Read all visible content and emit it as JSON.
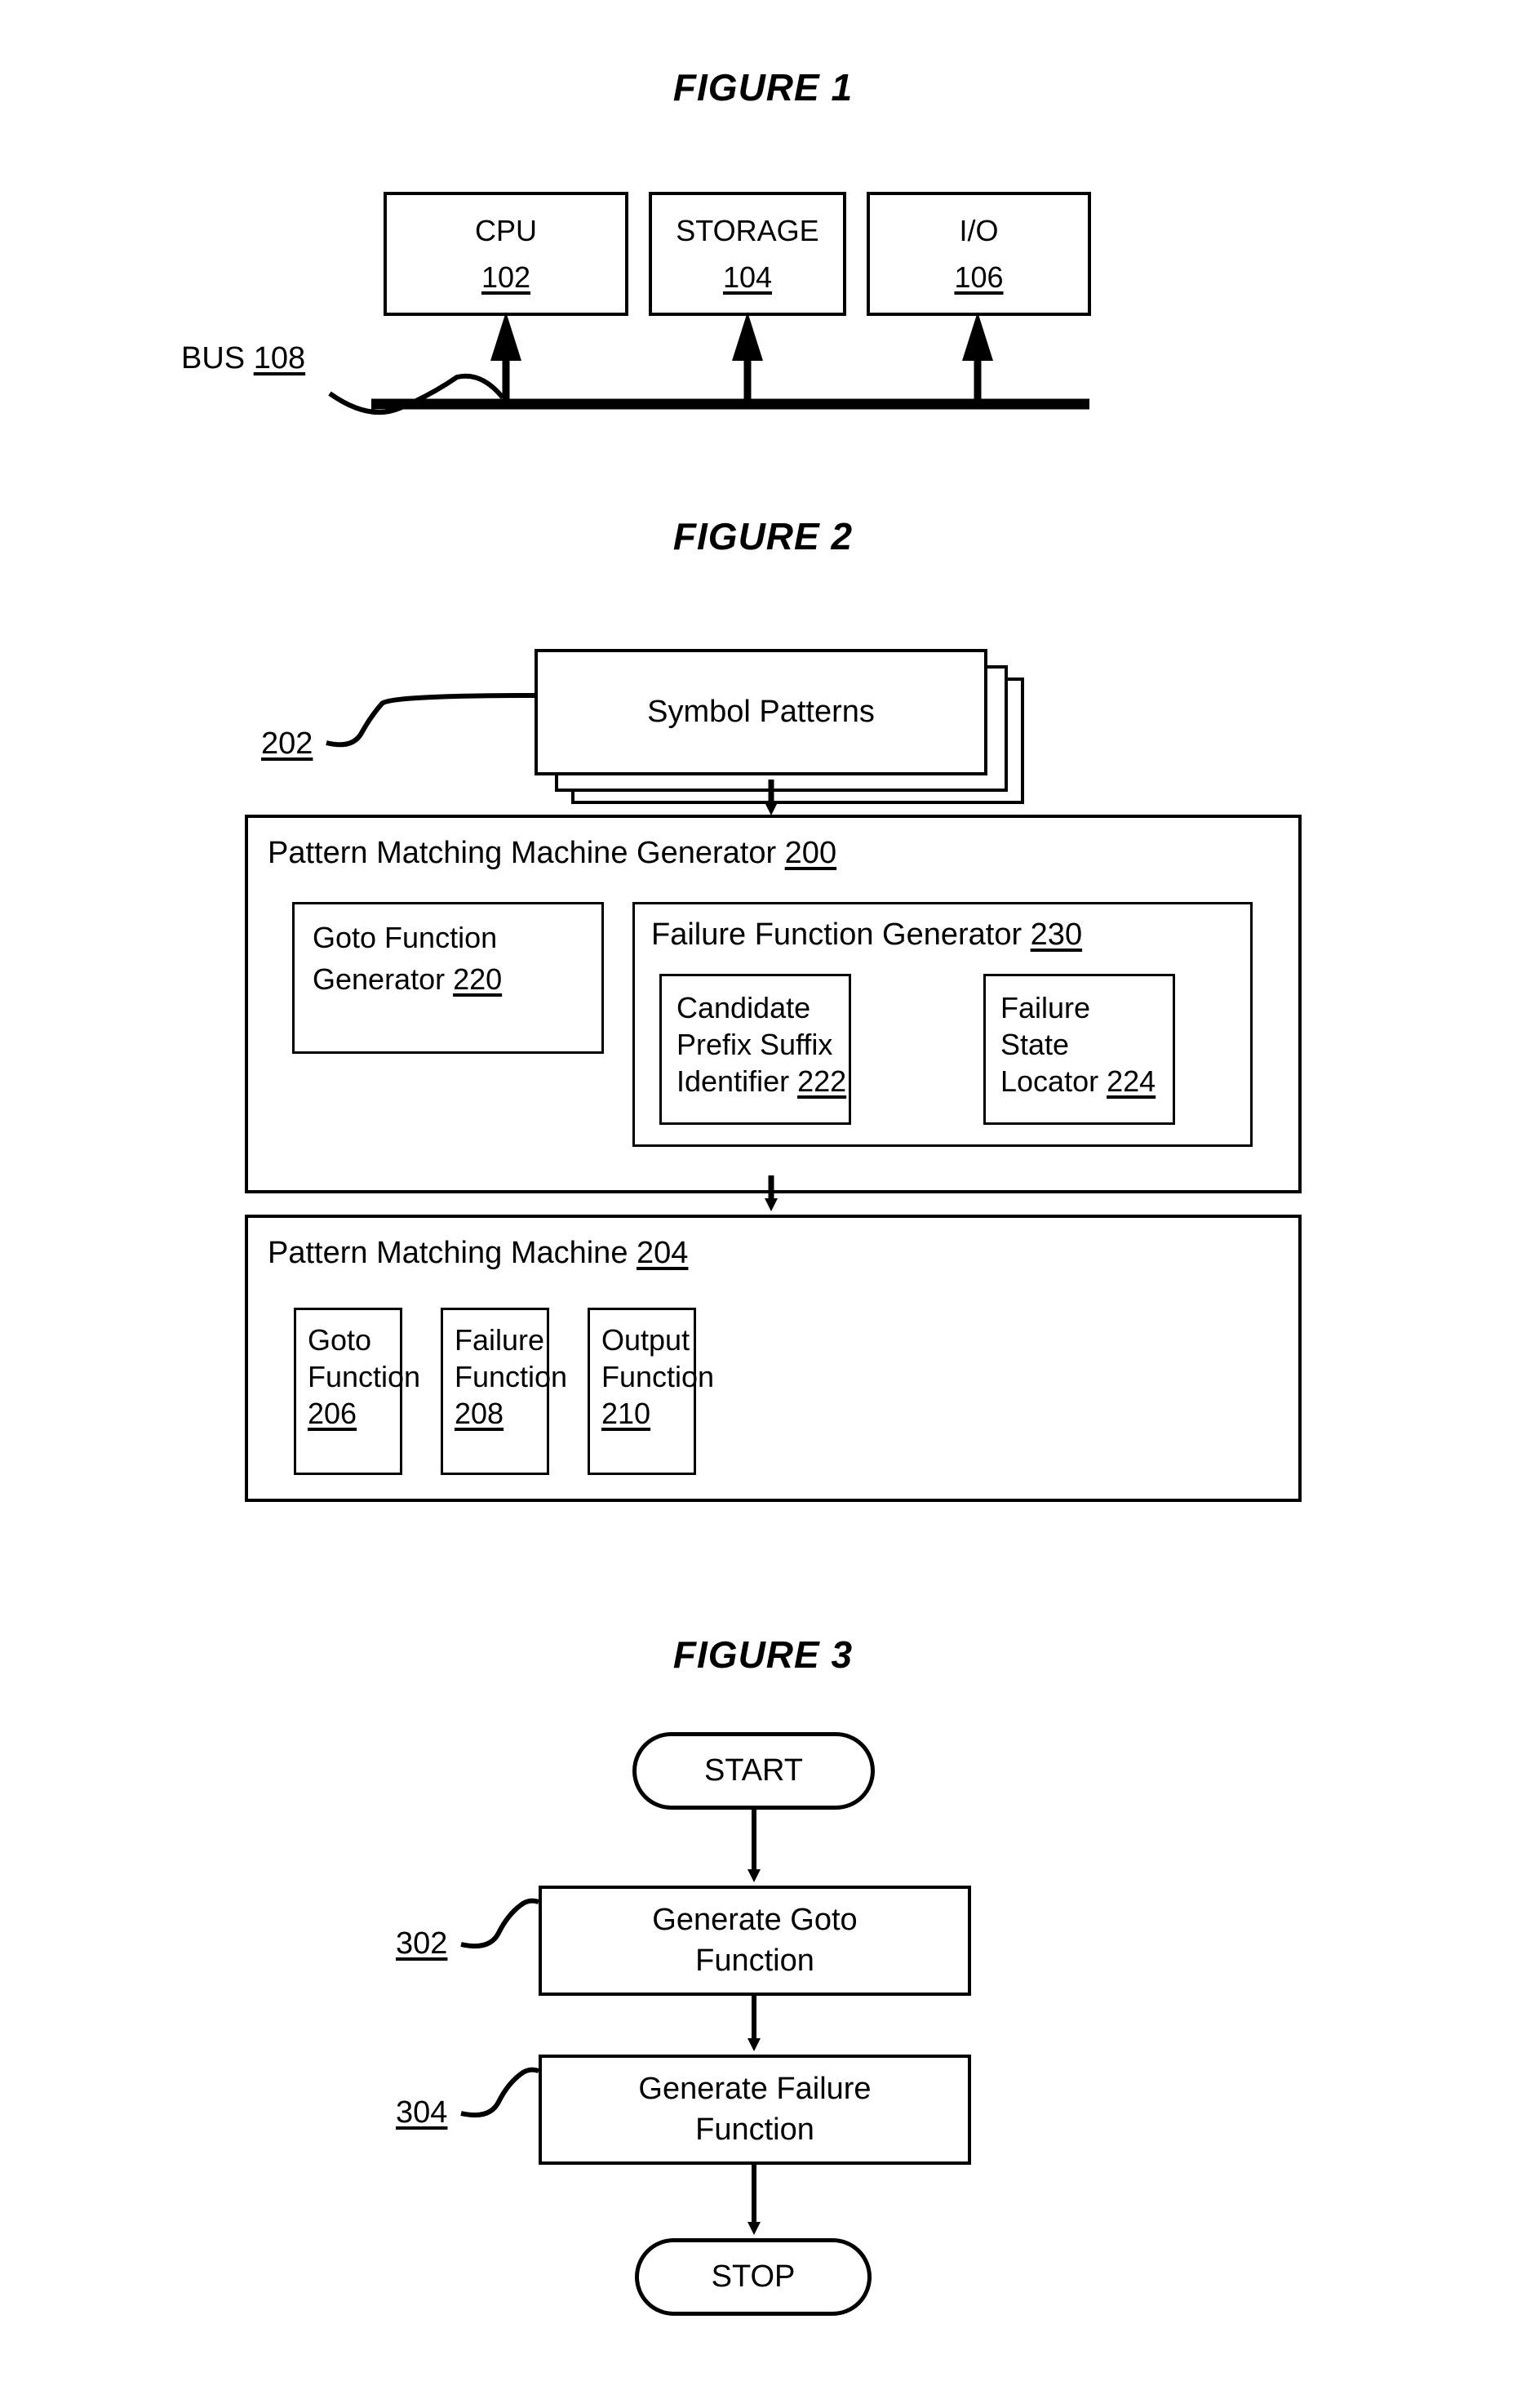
{
  "figure1": {
    "title": "FIGURE 1",
    "blocks": [
      {
        "label": "CPU",
        "ref": "102"
      },
      {
        "label": "STORAGE",
        "ref": "104"
      },
      {
        "label": "I/O",
        "ref": "106"
      }
    ],
    "bus": {
      "label": "BUS",
      "ref": "108"
    }
  },
  "figure2": {
    "title": "FIGURE 2",
    "input": {
      "label": "Symbol Patterns",
      "ref": "202"
    },
    "generator": {
      "header_label": "Pattern Matching Machine Generator",
      "header_ref": "200",
      "goto_generator": {
        "line1": "Goto Function",
        "line2": "Generator",
        "ref": "220"
      },
      "failure_generator": {
        "header_label": "Failure Function Generator",
        "header_ref": "230",
        "children": [
          {
            "line1": "Candidate",
            "line2": "Prefix Suffix",
            "line3": "Identifier",
            "ref": "222"
          },
          {
            "line1": "Failure",
            "line2": "State",
            "line3": "Locator",
            "ref": "224"
          }
        ]
      }
    },
    "machine": {
      "header_label": "Pattern Matching Machine",
      "header_ref": "204",
      "children": [
        {
          "line1": "Goto",
          "line2": "Function",
          "ref": "206"
        },
        {
          "line1": "Failure",
          "line2": "Function",
          "ref": "208"
        },
        {
          "line1": "Output",
          "line2": "Function",
          "ref": "210"
        }
      ]
    }
  },
  "figure3": {
    "title": "FIGURE 3",
    "start": "START",
    "stop": "STOP",
    "steps": [
      {
        "line1": "Generate Goto",
        "line2": "Function",
        "ref": "302"
      },
      {
        "line1": "Generate Failure",
        "line2": "Function",
        "ref": "304"
      }
    ]
  }
}
